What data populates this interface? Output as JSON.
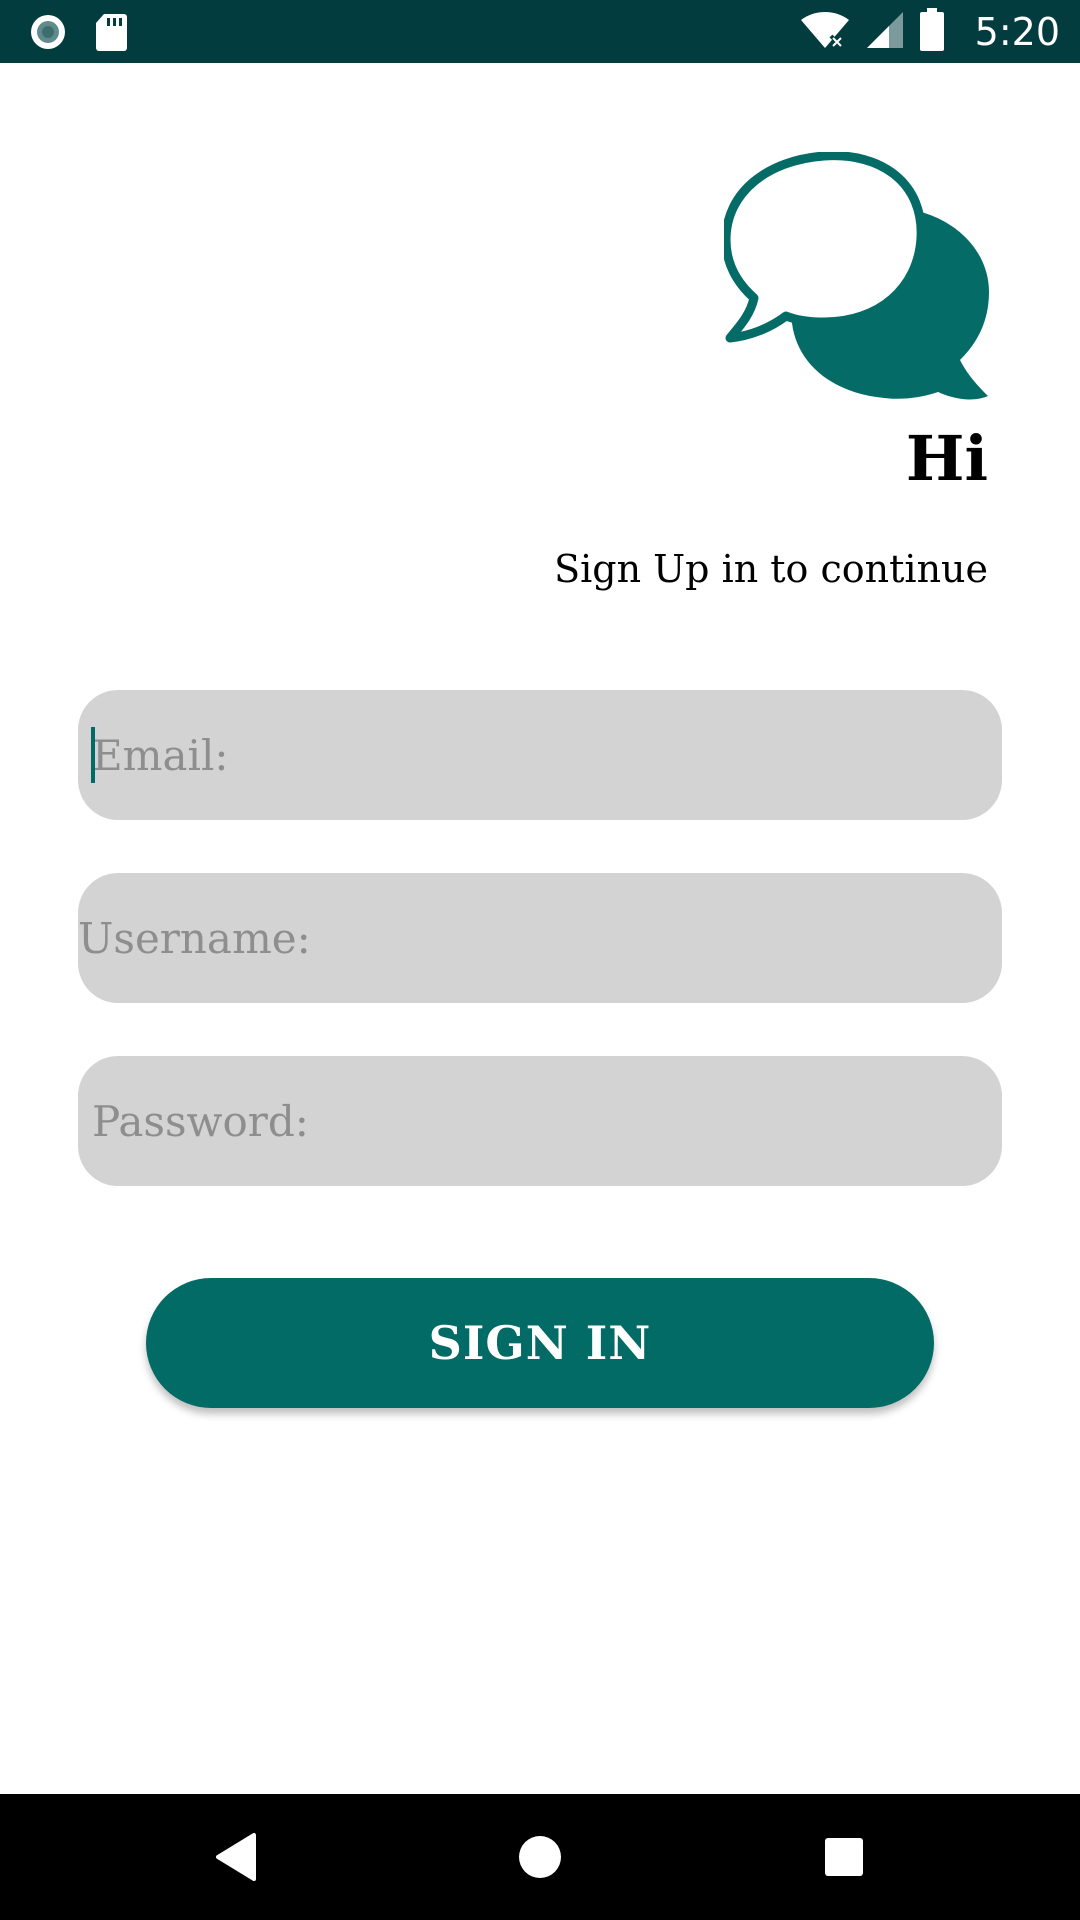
{
  "status_bar": {
    "time": "5:20",
    "left_icons": [
      "record-icon",
      "sd-card-icon"
    ],
    "right_icons": [
      "wifi-icon",
      "signal-icon",
      "battery-icon"
    ],
    "background": "#033c3f"
  },
  "header": {
    "logo_icon": "chat-bubbles-icon",
    "greeting": "Hi",
    "subtitle": "Sign Up in to continue"
  },
  "form": {
    "email": {
      "value": "",
      "placeholder": "Email:"
    },
    "username": {
      "value": "",
      "placeholder": "Username:"
    },
    "password": {
      "value": "",
      "placeholder": "Password:"
    }
  },
  "actions": {
    "signin_label": "SIGN IN"
  },
  "nav_bar": {
    "buttons": [
      "back-icon",
      "home-icon",
      "recents-icon"
    ]
  },
  "colors": {
    "accent": "#036b66",
    "field_bg": "#d3d3d3",
    "placeholder": "#8e8e8e"
  }
}
